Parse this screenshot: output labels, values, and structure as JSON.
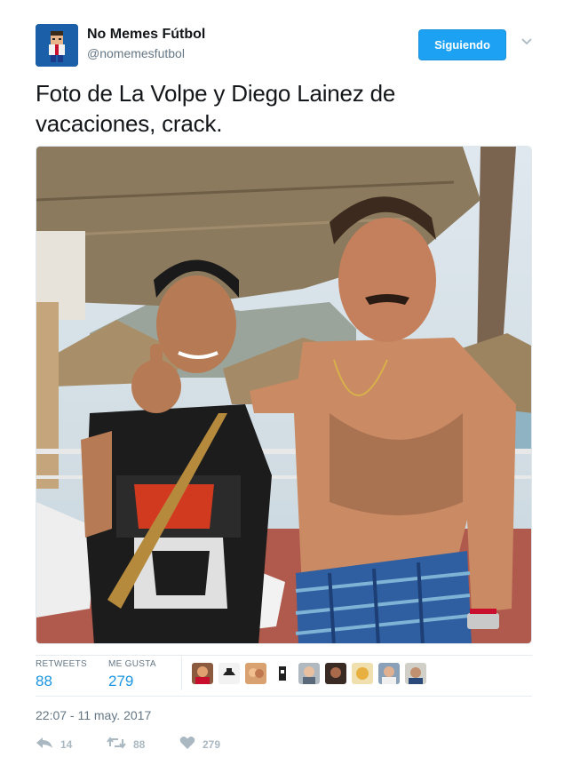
{
  "account": {
    "display_name": "No Memes Fútbol",
    "handle": "@nomemesfutbol",
    "avatar_icon": "pixel-character-avatar",
    "brand_color": "#1b5fa8"
  },
  "follow_button": {
    "label": "Siguiendo",
    "color": "#1da1f2"
  },
  "menu_icon": "chevron-down-icon",
  "tweet": {
    "text_line1": "Foto de La Volpe y Diego Lainez de",
    "text_line2": "vacaciones, crack.",
    "photo_icon": "beach-photo"
  },
  "stats": {
    "retweets_label": "RETWEETS",
    "retweets_value": "88",
    "likes_label": "ME GUSTA",
    "likes_value": "279",
    "accent_color": "#1b95e0"
  },
  "likers": [
    {
      "icon": "user-avatar"
    },
    {
      "icon": "user-avatar"
    },
    {
      "icon": "user-avatar"
    },
    {
      "icon": "user-avatar"
    },
    {
      "icon": "user-avatar"
    },
    {
      "icon": "user-avatar"
    },
    {
      "icon": "user-avatar"
    },
    {
      "icon": "user-avatar"
    },
    {
      "icon": "user-avatar"
    }
  ],
  "timestamp": "22:07 - 11 may. 2017",
  "actions": {
    "reply_count": "14",
    "retweet_count": "88",
    "like_count": "279"
  }
}
